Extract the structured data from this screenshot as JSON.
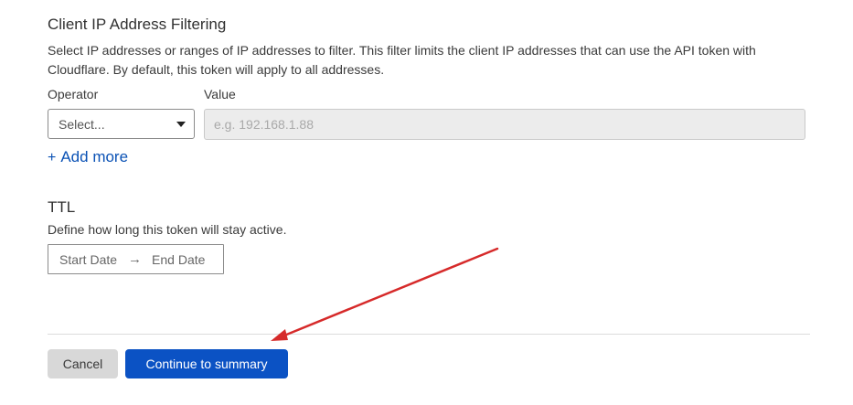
{
  "ip_filtering": {
    "title": "Client IP Address Filtering",
    "description": "Select IP addresses or ranges of IP addresses to filter. This filter limits the client IP addresses that can use the API token with Cloudflare. By default, this token will apply to all addresses.",
    "operator_label": "Operator",
    "value_label": "Value",
    "operator_selected": "Select...",
    "value_placeholder": "e.g. 192.168.1.88",
    "add_more_icon": "+",
    "add_more_label": "Add more"
  },
  "ttl": {
    "title": "TTL",
    "description": "Define how long this token will stay active.",
    "start_date_placeholder": "Start Date",
    "arrow_icon": "→",
    "end_date_placeholder": "End Date"
  },
  "actions": {
    "cancel_label": "Cancel",
    "continue_label": "Continue to summary"
  },
  "colors": {
    "primary": "#0b52c4",
    "link": "#0b52b5",
    "annotation": "#d62a2a"
  }
}
